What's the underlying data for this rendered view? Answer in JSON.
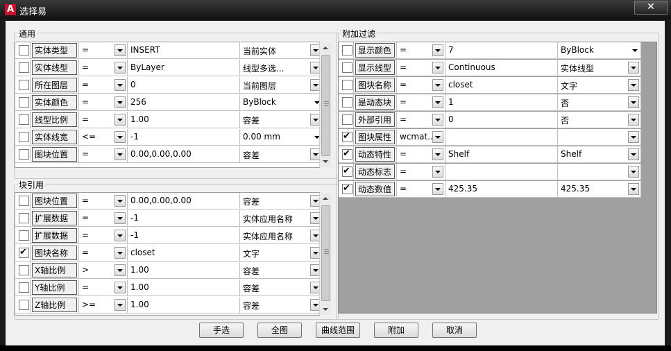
{
  "window": {
    "title": "选择易",
    "close_glyph": "✕"
  },
  "general": {
    "title": "通用",
    "rows": [
      {
        "checked": false,
        "property": "实体类型",
        "operator": "=",
        "value": "INSERT",
        "option": "当前实体"
      },
      {
        "checked": false,
        "property": "实体线型",
        "operator": "=",
        "value": "ByLayer",
        "option": "线型多选..."
      },
      {
        "checked": false,
        "property": "所在图层",
        "operator": "=",
        "value": "0",
        "option": "当前图层"
      },
      {
        "checked": false,
        "property": "实体颜色",
        "operator": "=",
        "value": "256",
        "option": "ByBlock"
      },
      {
        "checked": false,
        "property": "线型比例",
        "operator": "=",
        "value": "1.00",
        "option": "容差"
      },
      {
        "checked": false,
        "property": "实体线宽",
        "operator": "<=",
        "value": "-1",
        "option": "0.00 mm"
      },
      {
        "checked": false,
        "property": "图块位置",
        "operator": "=",
        "value": "0.00,0.00,0.00",
        "option": "容差"
      }
    ]
  },
  "block": {
    "title": "块引用",
    "rows": [
      {
        "checked": false,
        "property": "图块位置",
        "operator": "=",
        "value": "0.00,0.00,0.00",
        "option": "容差"
      },
      {
        "checked": false,
        "property": "扩展数据",
        "operator": "=",
        "value": "-1",
        "option": "实体应用名称"
      },
      {
        "checked": false,
        "property": "扩展数据",
        "operator": "=",
        "value": "-1",
        "option": "实体应用名称"
      },
      {
        "checked": true,
        "property": "图块名称",
        "operator": "=",
        "value": "closet",
        "option": "文字"
      },
      {
        "checked": false,
        "property": "X轴比例",
        "operator": ">",
        "value": "1.00",
        "option": "容差"
      },
      {
        "checked": false,
        "property": "Y轴比例",
        "operator": "=",
        "value": "1.00",
        "option": "容差"
      },
      {
        "checked": false,
        "property": "Z轴比例",
        "operator": ">=",
        "value": "1.00",
        "option": "容差"
      }
    ]
  },
  "extra": {
    "title": "附加过滤",
    "rows": [
      {
        "checked": false,
        "property": "显示颜色",
        "operator": "=",
        "value": "7",
        "option": "ByBlock"
      },
      {
        "checked": false,
        "property": "显示线型",
        "operator": "=",
        "value": "Continuous",
        "option": "实体线型"
      },
      {
        "checked": false,
        "property": "图块名称",
        "operator": "=",
        "value": "closet",
        "option": "文字"
      },
      {
        "checked": false,
        "property": "是动态块",
        "operator": "=",
        "value": "1",
        "option": "否"
      },
      {
        "checked": false,
        "property": "外部引用",
        "operator": "=",
        "value": "0",
        "option": "否"
      },
      {
        "checked": true,
        "property": "图块属性",
        "operator": "wcmat...",
        "value": "",
        "option": ""
      },
      {
        "checked": true,
        "property": "动态特性",
        "operator": "=",
        "value": "Shelf",
        "option": "Shelf"
      },
      {
        "checked": true,
        "property": "动态标志",
        "operator": "=",
        "value": "",
        "option": ""
      },
      {
        "checked": true,
        "property": "动态数值",
        "operator": "=",
        "value": "425.35",
        "option": "425.35"
      }
    ]
  },
  "buttons": [
    "手选",
    "全图",
    "曲线范围",
    "附加",
    "取消"
  ]
}
